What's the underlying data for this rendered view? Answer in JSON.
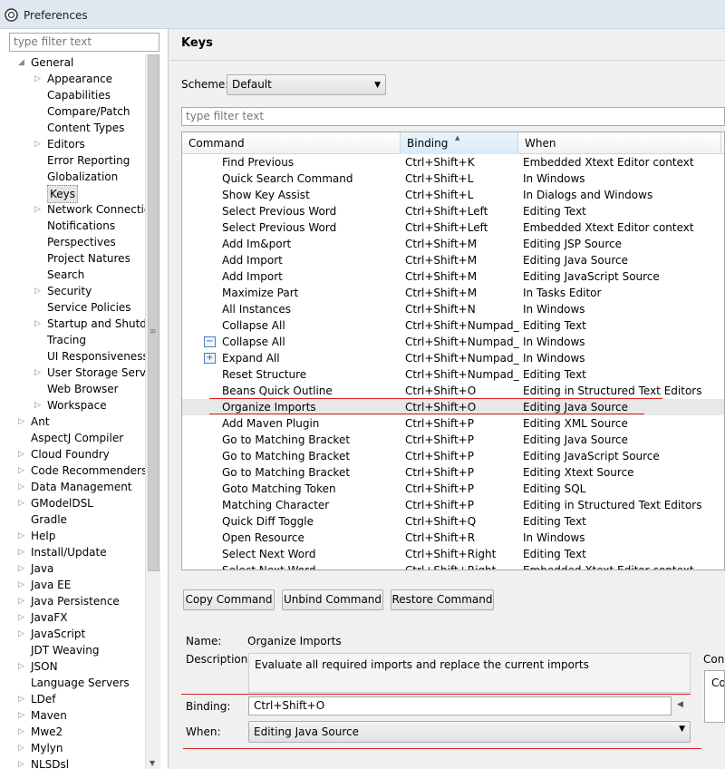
{
  "window": {
    "title": "Preferences"
  },
  "left_panel": {
    "filter_placeholder": "type filter text",
    "tree": [
      {
        "label": "General",
        "depth": 0,
        "toggle": "expanded"
      },
      {
        "label": "Appearance",
        "depth": 1,
        "toggle": "collapsed"
      },
      {
        "label": "Capabilities",
        "depth": 1,
        "toggle": "none"
      },
      {
        "label": "Compare/Patch",
        "depth": 1,
        "toggle": "none"
      },
      {
        "label": "Content Types",
        "depth": 1,
        "toggle": "none"
      },
      {
        "label": "Editors",
        "depth": 1,
        "toggle": "collapsed"
      },
      {
        "label": "Error Reporting",
        "depth": 1,
        "toggle": "none"
      },
      {
        "label": "Globalization",
        "depth": 1,
        "toggle": "none"
      },
      {
        "label": "Keys",
        "depth": 1,
        "toggle": "none",
        "selected": true
      },
      {
        "label": "Network Connection",
        "depth": 1,
        "toggle": "collapsed"
      },
      {
        "label": "Notifications",
        "depth": 1,
        "toggle": "none"
      },
      {
        "label": "Perspectives",
        "depth": 1,
        "toggle": "none"
      },
      {
        "label": "Project Natures",
        "depth": 1,
        "toggle": "none"
      },
      {
        "label": "Search",
        "depth": 1,
        "toggle": "none"
      },
      {
        "label": "Security",
        "depth": 1,
        "toggle": "collapsed"
      },
      {
        "label": "Service Policies",
        "depth": 1,
        "toggle": "none"
      },
      {
        "label": "Startup and Shutdown",
        "depth": 1,
        "toggle": "collapsed"
      },
      {
        "label": "Tracing",
        "depth": 1,
        "toggle": "none"
      },
      {
        "label": "UI Responsiveness M",
        "depth": 1,
        "toggle": "none"
      },
      {
        "label": "User Storage Service",
        "depth": 1,
        "toggle": "collapsed"
      },
      {
        "label": "Web Browser",
        "depth": 1,
        "toggle": "none"
      },
      {
        "label": "Workspace",
        "depth": 1,
        "toggle": "collapsed"
      },
      {
        "label": "Ant",
        "depth": 0,
        "toggle": "collapsed"
      },
      {
        "label": "AspectJ Compiler",
        "depth": 0,
        "toggle": "none"
      },
      {
        "label": "Cloud Foundry",
        "depth": 0,
        "toggle": "collapsed"
      },
      {
        "label": "Code Recommenders",
        "depth": 0,
        "toggle": "collapsed"
      },
      {
        "label": "Data Management",
        "depth": 0,
        "toggle": "collapsed"
      },
      {
        "label": "GModelDSL",
        "depth": 0,
        "toggle": "collapsed"
      },
      {
        "label": "Gradle",
        "depth": 0,
        "toggle": "none"
      },
      {
        "label": "Help",
        "depth": 0,
        "toggle": "collapsed"
      },
      {
        "label": "Install/Update",
        "depth": 0,
        "toggle": "collapsed"
      },
      {
        "label": "Java",
        "depth": 0,
        "toggle": "collapsed"
      },
      {
        "label": "Java EE",
        "depth": 0,
        "toggle": "collapsed"
      },
      {
        "label": "Java Persistence",
        "depth": 0,
        "toggle": "collapsed"
      },
      {
        "label": "JavaFX",
        "depth": 0,
        "toggle": "collapsed"
      },
      {
        "label": "JavaScript",
        "depth": 0,
        "toggle": "collapsed"
      },
      {
        "label": "JDT Weaving",
        "depth": 0,
        "toggle": "none"
      },
      {
        "label": "JSON",
        "depth": 0,
        "toggle": "collapsed"
      },
      {
        "label": "Language Servers",
        "depth": 0,
        "toggle": "none"
      },
      {
        "label": "LDef",
        "depth": 0,
        "toggle": "collapsed"
      },
      {
        "label": "Maven",
        "depth": 0,
        "toggle": "collapsed"
      },
      {
        "label": "Mwe2",
        "depth": 0,
        "toggle": "collapsed"
      },
      {
        "label": "Mylyn",
        "depth": 0,
        "toggle": "collapsed"
      },
      {
        "label": "NLSDsl",
        "depth": 0,
        "toggle": "collapsed"
      }
    ]
  },
  "page": {
    "title": "Keys",
    "scheme_label": "Scheme:",
    "scheme_value": "Default",
    "filter_placeholder": "type filter text",
    "columns": [
      "Command",
      "Binding",
      "When"
    ],
    "rows": [
      {
        "command": "Find Previous",
        "binding": "Ctrl+Shift+K",
        "when": "Embedded Xtext Editor context"
      },
      {
        "command": "Quick Search Command",
        "binding": "Ctrl+Shift+L",
        "when": "In Windows"
      },
      {
        "command": "Show Key Assist",
        "binding": "Ctrl+Shift+L",
        "when": "In Dialogs and Windows"
      },
      {
        "command": "Select Previous Word",
        "binding": "Ctrl+Shift+Left",
        "when": "Editing Text"
      },
      {
        "command": "Select Previous Word",
        "binding": "Ctrl+Shift+Left",
        "when": "Embedded Xtext Editor context"
      },
      {
        "command": "Add Im&port",
        "binding": "Ctrl+Shift+M",
        "when": "Editing JSP Source"
      },
      {
        "command": "Add Import",
        "binding": "Ctrl+Shift+M",
        "when": "Editing Java Source"
      },
      {
        "command": "Add Import",
        "binding": "Ctrl+Shift+M",
        "when": "Editing JavaScript Source"
      },
      {
        "command": "Maximize Part",
        "binding": "Ctrl+Shift+M",
        "when": "In Tasks Editor"
      },
      {
        "command": "All Instances",
        "binding": "Ctrl+Shift+N",
        "when": "In Windows"
      },
      {
        "command": "Collapse All",
        "binding": "Ctrl+Shift+Numpad_",
        "when": "Editing Text"
      },
      {
        "command": "Collapse All",
        "binding": "Ctrl+Shift+Numpad_",
        "when": "In Windows",
        "icon": "collapse-all-icon"
      },
      {
        "command": "Expand All",
        "binding": "Ctrl+Shift+Numpad_",
        "when": "In Windows",
        "icon": "expand-all-icon"
      },
      {
        "command": "Reset Structure",
        "binding": "Ctrl+Shift+Numpad_",
        "when": "Editing Text"
      },
      {
        "command": "Beans Quick Outline",
        "binding": "Ctrl+Shift+O",
        "when": "Editing in Structured Text Editors"
      },
      {
        "command": "Organize Imports",
        "binding": "Ctrl+Shift+O",
        "when": "Editing Java Source",
        "selected": true
      },
      {
        "command": "Add Maven Plugin",
        "binding": "Ctrl+Shift+P",
        "when": "Editing XML Source"
      },
      {
        "command": "Go to Matching Bracket",
        "binding": "Ctrl+Shift+P",
        "when": "Editing Java Source"
      },
      {
        "command": "Go to Matching Bracket",
        "binding": "Ctrl+Shift+P",
        "when": "Editing JavaScript Source"
      },
      {
        "command": "Go to Matching Bracket",
        "binding": "Ctrl+Shift+P",
        "when": "Editing Xtext Source"
      },
      {
        "command": "Goto Matching Token",
        "binding": "Ctrl+Shift+P",
        "when": "Editing SQL"
      },
      {
        "command": "Matching Character",
        "binding": "Ctrl+Shift+P",
        "when": "Editing in Structured Text Editors"
      },
      {
        "command": "Quick Diff Toggle",
        "binding": "Ctrl+Shift+Q",
        "when": "Editing Text"
      },
      {
        "command": "Open Resource",
        "binding": "Ctrl+Shift+R",
        "when": "In Windows"
      },
      {
        "command": "Select Next Word",
        "binding": "Ctrl+Shift+Right",
        "when": "Editing Text"
      },
      {
        "command": "Select Next Word",
        "binding": "Ctrl+Shift+Right",
        "when": "Embedded Xtext Editor context"
      }
    ],
    "buttons": {
      "copy": "Copy Command",
      "unbind": "Unbind Command",
      "restore": "Restore Command"
    },
    "details": {
      "name_label": "Name:",
      "name_value": "Organize Imports",
      "description_label": "Description:",
      "description_value": "Evaluate all required imports and replace the current imports",
      "binding_label": "Binding:",
      "binding_value": "Ctrl+Shift+O",
      "when_label": "When:",
      "when_value": "Editing Java Source",
      "conflicts_label": "Con",
      "conflicts_column": "Co"
    }
  },
  "colors": {
    "annotation_red": "#d62020",
    "selection_gray": "#e8e8e8"
  }
}
